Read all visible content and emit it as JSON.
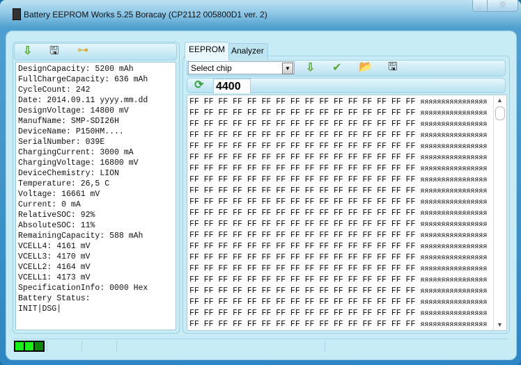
{
  "window": {
    "title": "Battery EEPROM Works  5.25 Boracay (CP2112 005800D1 ver. 2)",
    "minimize": "_",
    "close": "X"
  },
  "left_panel": {
    "toolbar": [
      "download-icon",
      "save-icon",
      "tree-icon"
    ],
    "lines": [
      "DesignCapacity: 5200 mAh",
      "FullChargeCapacity: 636 mAh",
      "CycleCount: 242",
      "Date: 2014.09.11 yyyy.mm.dd",
      "DesignVoltage: 14800 mV",
      "ManufName: SMP-SDI26H",
      "DeviceName: P150HM....",
      "SerialNumber: 039E",
      "ChargingCurrent: 3000 mA",
      "ChargingVoltage: 16800 mV",
      "DeviceChemistry: LION",
      "Temperature: 26,5 C",
      "Voltage: 16661 mV",
      "Current: 0 mA",
      "RelativeSOC: 92%",
      "AbsoluteSOC: 11%",
      "RemainingCapacity: 588 mAh",
      "VCELL4: 4161 mV",
      "VCELL3: 4170 mV",
      "VCELL2: 4164 mV",
      "VCELL1: 4173 mV",
      "SpecificationInfo: 0000 Hex",
      "Battery Status:",
      "INIT|DSG|"
    ]
  },
  "tabs": [
    {
      "label": "EEPROM",
      "active": true
    },
    {
      "label": "Analyzer",
      "active": false
    }
  ],
  "toolbar": {
    "chip_select": "Select chip",
    "address": "4400"
  },
  "hex": {
    "row_hex": "FF FF FF FF FF FF FF FF FF FF FF FF FF FF FF FF",
    "row_ascii": "яяяяяяяяяяяяяяяя",
    "row_count": 22
  },
  "status": {
    "leds": [
      "on",
      "on",
      "dim"
    ],
    "led_colors": [
      "#17ef17",
      "#17ef17",
      "#0b860b"
    ]
  }
}
